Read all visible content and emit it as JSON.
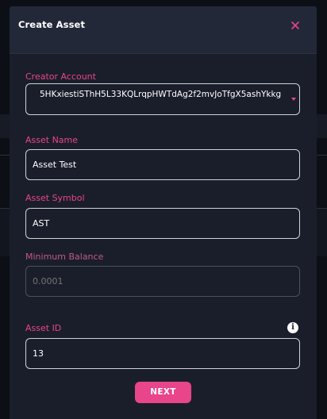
{
  "modal": {
    "title": "Create Asset"
  },
  "creator_account": {
    "label": "Creator Account",
    "selected_value": "5HKxiestiSThH5L33KQLrqpHWTdAg2f2mvJoTfgX5ashYkkg"
  },
  "asset_name": {
    "label": "Asset Name",
    "value": "Asset Test"
  },
  "asset_symbol": {
    "label": "Asset Symbol",
    "value": "AST"
  },
  "minimum_balance": {
    "label": "Minimum Balance",
    "placeholder": "0.0001"
  },
  "asset_id": {
    "label": "Asset ID",
    "value": "13",
    "info_glyph": "i"
  },
  "actions": {
    "next_label": "NEXT"
  },
  "colors": {
    "accent": "#e8458b",
    "modal_bg": "#1a1e2b",
    "header_bg": "#222838"
  }
}
